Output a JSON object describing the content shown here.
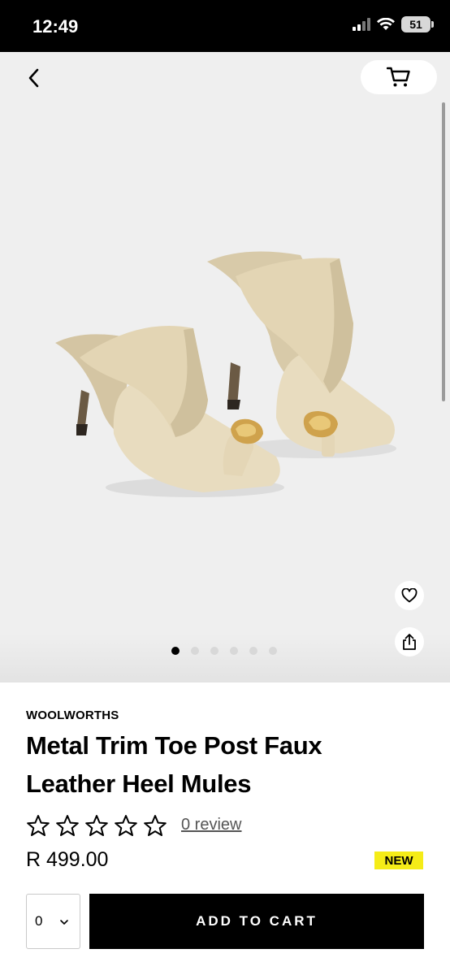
{
  "status_bar": {
    "time": "12:49",
    "battery": "51"
  },
  "gallery": {
    "image_count": 6,
    "active_index": 0
  },
  "product": {
    "brand": "WOOLWORTHS",
    "title": "Metal Trim Toe Post Faux Leather Heel Mules",
    "rating": 0,
    "review_text": "0 review",
    "price": "R 499.00",
    "badge": "NEW"
  },
  "purchase": {
    "quantity": "0",
    "add_to_cart_label": "ADD TO CART"
  },
  "colors": {
    "badge": "#f5ec18",
    "primary_button": "#000000",
    "image_bg": "#efefef"
  },
  "icons": [
    "back-icon",
    "cart-icon",
    "heart-icon",
    "share-icon",
    "star-outline-icon",
    "chevron-down-icon"
  ]
}
